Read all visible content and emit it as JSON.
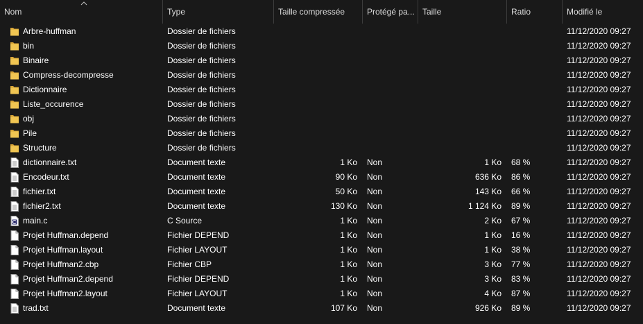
{
  "columns": {
    "name": "Nom",
    "type": "Type",
    "compressed": "Taille compressée",
    "protected": "Protégé pa...",
    "size": "Taille",
    "ratio": "Ratio",
    "modified": "Modifié le"
  },
  "colors": {
    "background": "#191919",
    "folder": "#f0c552",
    "header_divider": "#3c3c3c"
  },
  "rows": [
    {
      "icon": "folder-icon",
      "name": "Arbre-huffman",
      "type": "Dossier de fichiers",
      "compressed": "",
      "protected": "",
      "size": "",
      "ratio": "",
      "modified": "11/12/2020 09:27"
    },
    {
      "icon": "folder-icon",
      "name": "bin",
      "type": "Dossier de fichiers",
      "compressed": "",
      "protected": "",
      "size": "",
      "ratio": "",
      "modified": "11/12/2020 09:27"
    },
    {
      "icon": "folder-icon",
      "name": "Binaire",
      "type": "Dossier de fichiers",
      "compressed": "",
      "protected": "",
      "size": "",
      "ratio": "",
      "modified": "11/12/2020 09:27"
    },
    {
      "icon": "folder-icon",
      "name": "Compress-decompresse",
      "type": "Dossier de fichiers",
      "compressed": "",
      "protected": "",
      "size": "",
      "ratio": "",
      "modified": "11/12/2020 09:27"
    },
    {
      "icon": "folder-icon",
      "name": "Dictionnaire",
      "type": "Dossier de fichiers",
      "compressed": "",
      "protected": "",
      "size": "",
      "ratio": "",
      "modified": "11/12/2020 09:27"
    },
    {
      "icon": "folder-icon",
      "name": "Liste_occurence",
      "type": "Dossier de fichiers",
      "compressed": "",
      "protected": "",
      "size": "",
      "ratio": "",
      "modified": "11/12/2020 09:27"
    },
    {
      "icon": "folder-icon",
      "name": "obj",
      "type": "Dossier de fichiers",
      "compressed": "",
      "protected": "",
      "size": "",
      "ratio": "",
      "modified": "11/12/2020 09:27"
    },
    {
      "icon": "folder-icon",
      "name": "Pile",
      "type": "Dossier de fichiers",
      "compressed": "",
      "protected": "",
      "size": "",
      "ratio": "",
      "modified": "11/12/2020 09:27"
    },
    {
      "icon": "folder-icon",
      "name": "Structure",
      "type": "Dossier de fichiers",
      "compressed": "",
      "protected": "",
      "size": "",
      "ratio": "",
      "modified": "11/12/2020 09:27"
    },
    {
      "icon": "text-document-icon",
      "name": "dictionnaire.txt",
      "type": "Document texte",
      "compressed": "1 Ko",
      "protected": "Non",
      "size": "1 Ko",
      "ratio": "68 %",
      "modified": "11/12/2020 09:27"
    },
    {
      "icon": "text-document-icon",
      "name": "Encodeur.txt",
      "type": "Document texte",
      "compressed": "90 Ko",
      "protected": "Non",
      "size": "636 Ko",
      "ratio": "86 %",
      "modified": "11/12/2020 09:27"
    },
    {
      "icon": "text-document-icon",
      "name": "fichier.txt",
      "type": "Document texte",
      "compressed": "50 Ko",
      "protected": "Non",
      "size": "143 Ko",
      "ratio": "66 %",
      "modified": "11/12/2020 09:27"
    },
    {
      "icon": "text-document-icon",
      "name": "fichier2.txt",
      "type": "Document texte",
      "compressed": "130 Ko",
      "protected": "Non",
      "size": "1 124 Ko",
      "ratio": "89 %",
      "modified": "11/12/2020 09:27"
    },
    {
      "icon": "c-source-icon",
      "name": "main.c",
      "type": "C Source",
      "compressed": "1 Ko",
      "protected": "Non",
      "size": "2 Ko",
      "ratio": "67 %",
      "modified": "11/12/2020 09:27"
    },
    {
      "icon": "blank-file-icon",
      "name": "Projet Huffman.depend",
      "type": "Fichier DEPEND",
      "compressed": "1 Ko",
      "protected": "Non",
      "size": "1 Ko",
      "ratio": "16 %",
      "modified": "11/12/2020 09:27"
    },
    {
      "icon": "blank-file-icon",
      "name": "Projet Huffman.layout",
      "type": "Fichier LAYOUT",
      "compressed": "1 Ko",
      "protected": "Non",
      "size": "1 Ko",
      "ratio": "38 %",
      "modified": "11/12/2020 09:27"
    },
    {
      "icon": "blank-file-icon",
      "name": "Projet Huffman2.cbp",
      "type": "Fichier CBP",
      "compressed": "1 Ko",
      "protected": "Non",
      "size": "3 Ko",
      "ratio": "77 %",
      "modified": "11/12/2020 09:27"
    },
    {
      "icon": "blank-file-icon",
      "name": "Projet Huffman2.depend",
      "type": "Fichier DEPEND",
      "compressed": "1 Ko",
      "protected": "Non",
      "size": "3 Ko",
      "ratio": "83 %",
      "modified": "11/12/2020 09:27"
    },
    {
      "icon": "blank-file-icon",
      "name": "Projet Huffman2.layout",
      "type": "Fichier LAYOUT",
      "compressed": "1 Ko",
      "protected": "Non",
      "size": "4 Ko",
      "ratio": "87 %",
      "modified": "11/12/2020 09:27"
    },
    {
      "icon": "text-document-icon",
      "name": "trad.txt",
      "type": "Document texte",
      "compressed": "107 Ko",
      "protected": "Non",
      "size": "926 Ko",
      "ratio": "89 %",
      "modified": "11/12/2020 09:27"
    }
  ]
}
